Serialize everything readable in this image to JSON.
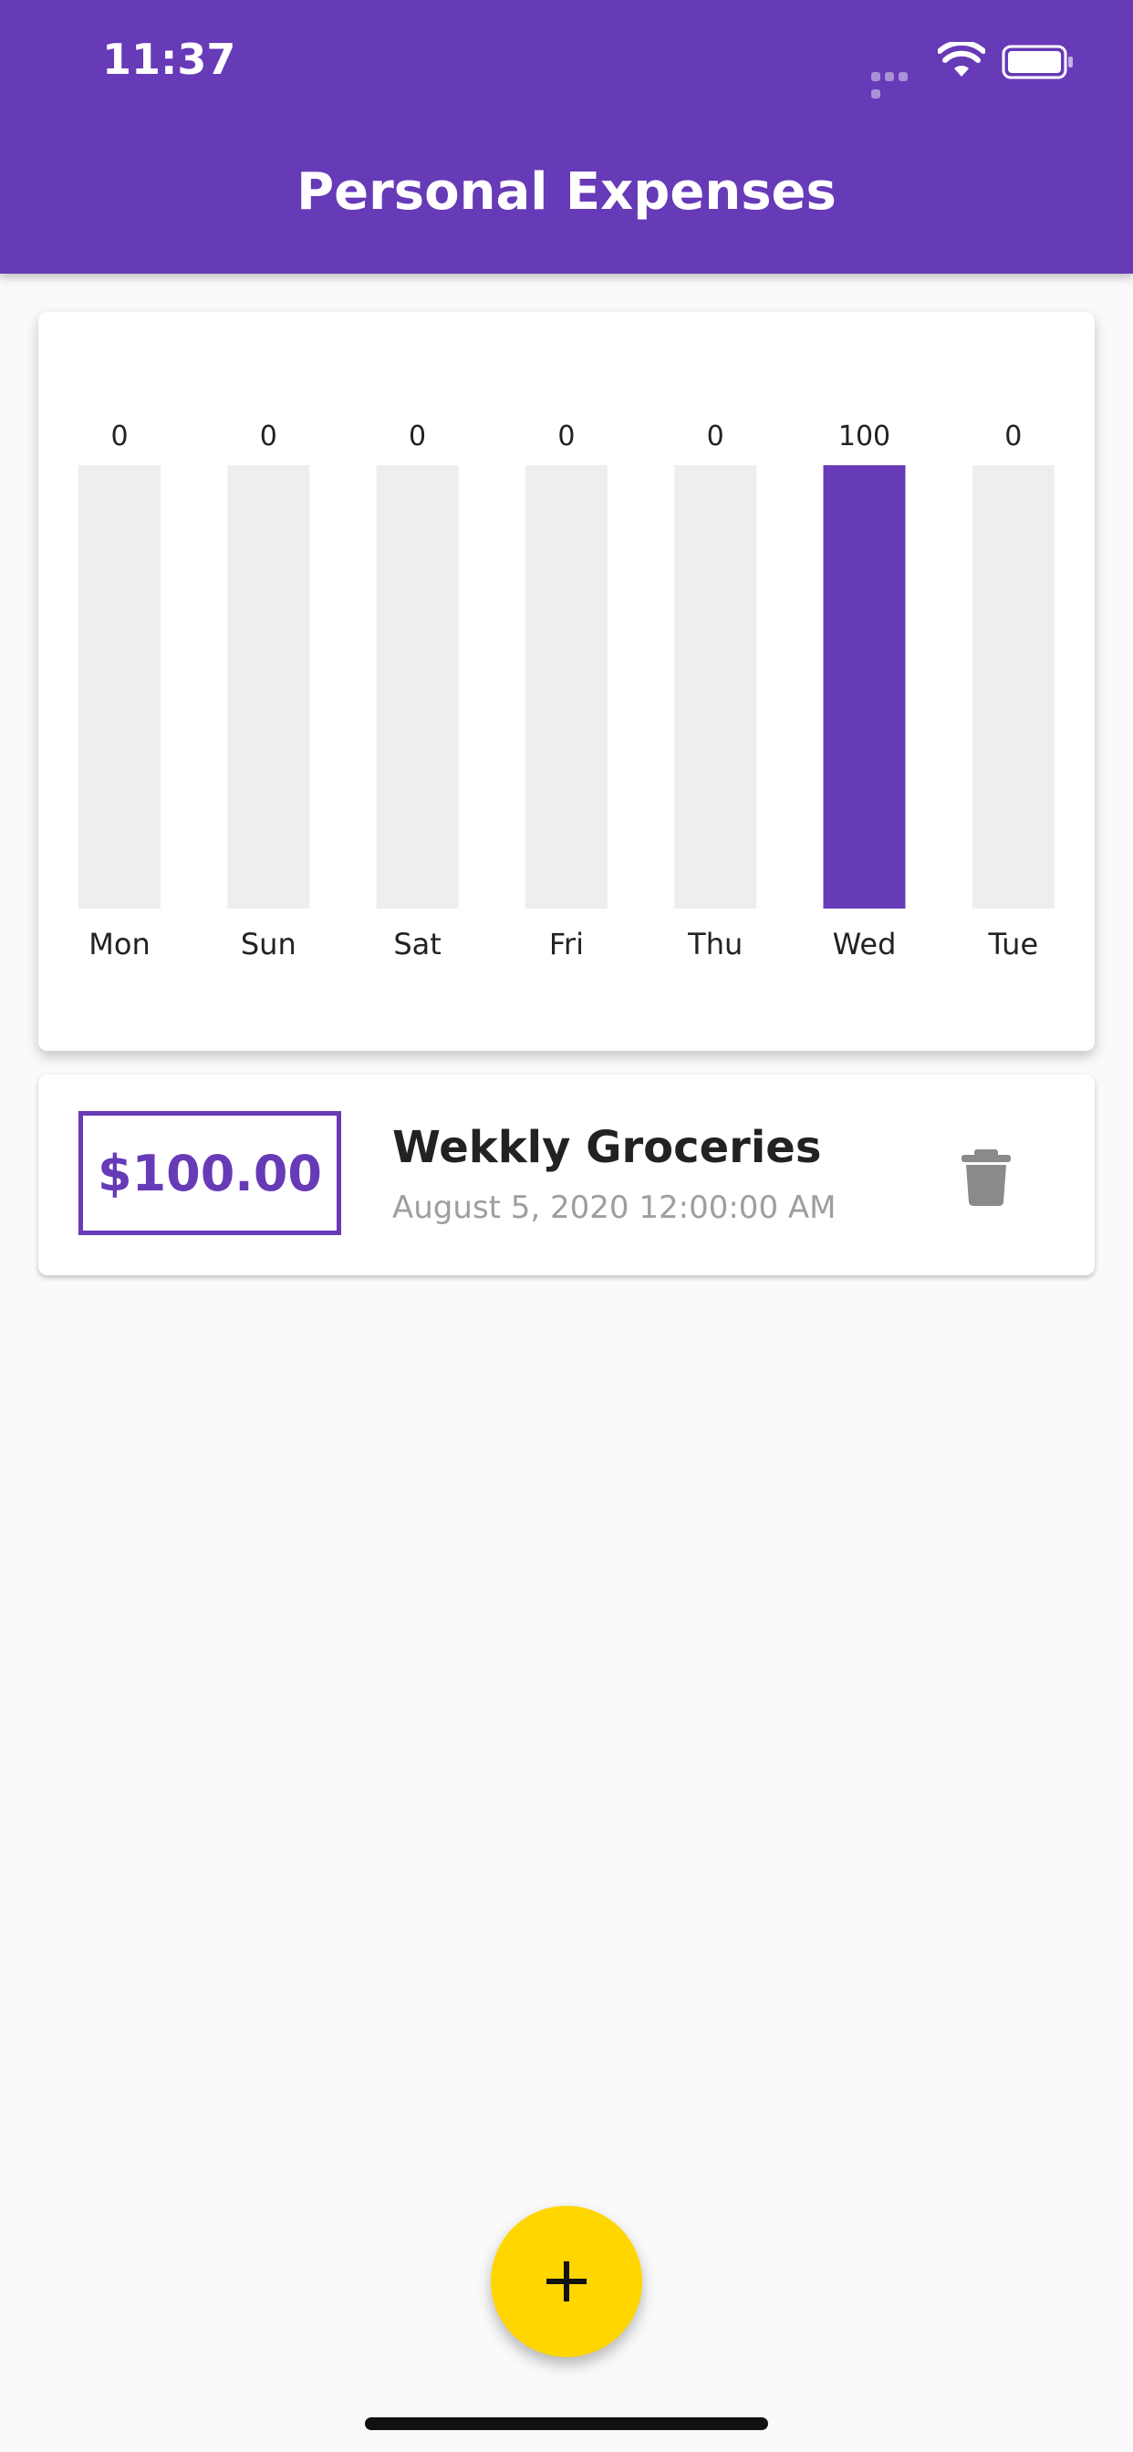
{
  "status_bar": {
    "time": "11:37"
  },
  "app_bar": {
    "title": "Personal Expenses"
  },
  "chart_data": {
    "type": "bar",
    "categories": [
      "Mon",
      "Sun",
      "Sat",
      "Fri",
      "Thu",
      "Wed",
      "Tue"
    ],
    "values": [
      0,
      0,
      0,
      0,
      0,
      100,
      0
    ],
    "value_labels": [
      "0",
      "0",
      "0",
      "0",
      "0",
      "100",
      "0"
    ],
    "bar_fraction": [
      0,
      0,
      0,
      0,
      0,
      1,
      0
    ],
    "fill_color": "#673AB7",
    "track_color": "#EEEEEE"
  },
  "transactions": [
    {
      "amount": "$100.00",
      "title": "Wekkly Groceries",
      "date": "August 5, 2020 12:00:00 AM"
    }
  ],
  "colors": {
    "primary": "#673AB7",
    "accent": "#FFD600"
  },
  "icons": {
    "delete": "trash-icon",
    "fab": "plus-icon"
  }
}
